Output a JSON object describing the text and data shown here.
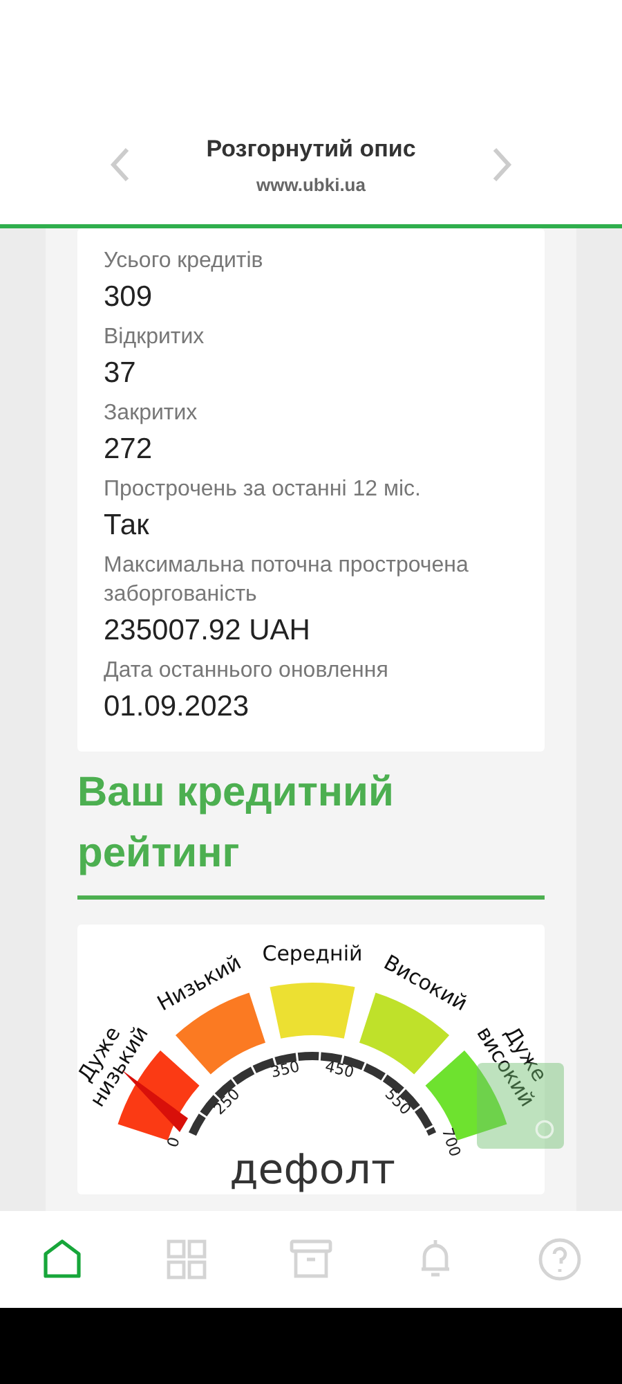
{
  "header": {
    "title": "Розгорнутий опис",
    "subtitle": "www.ubki.ua"
  },
  "summary": [
    {
      "label": "Усього кредитів",
      "value": "309"
    },
    {
      "label": "Відкритих",
      "value": "37"
    },
    {
      "label": "Закритих",
      "value": "272"
    },
    {
      "label": "Прострочень за останні 12 міс.",
      "value": "Так"
    },
    {
      "label": "Максимальна поточна прострочена заборгованість",
      "value": "235007.92 UAH"
    },
    {
      "label": "Дата останнього оновлення",
      "value": "01.09.2023"
    }
  ],
  "rating": {
    "heading": "Ваш кредитний рейтинг",
    "segments": [
      {
        "lines": [
          "Дуже",
          "низький"
        ],
        "color": "#fb3a14"
      },
      {
        "lines": [
          "Низький"
        ],
        "color": "#fb7a22"
      },
      {
        "lines": [
          "Середній"
        ],
        "color": "#ece032"
      },
      {
        "lines": [
          "Високий"
        ],
        "color": "#bfe12a"
      },
      {
        "lines": [
          "Дуже",
          "високий"
        ],
        "color": "#6ee22f"
      }
    ],
    "ticks": [
      "0",
      "250",
      "350",
      "450",
      "550",
      "700"
    ],
    "verdict": "дефолт"
  },
  "nav": [
    {
      "kind": "home",
      "selected": true
    },
    {
      "kind": "grid",
      "selected": false
    },
    {
      "kind": "archive",
      "selected": false
    },
    {
      "kind": "bell",
      "selected": false
    },
    {
      "kind": "help",
      "selected": false
    }
  ]
}
